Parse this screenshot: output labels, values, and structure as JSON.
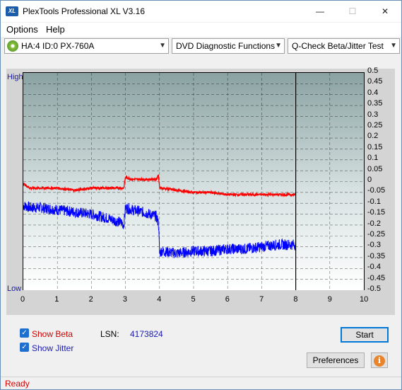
{
  "window": {
    "title": "PlexTools Professional XL V3.16",
    "logo_text": "XL"
  },
  "titlebar_buttons": {
    "minimize": "—",
    "maximize": "☐",
    "close": "✕"
  },
  "menu": {
    "options": "Options",
    "help": "Help"
  },
  "toolbar": {
    "drive": "HA:4 ID:0  PX-760A",
    "function": "DVD Diagnostic Functions",
    "test": "Q-Check Beta/Jitter Test"
  },
  "graph": {
    "label_high": "High",
    "label_low": "Low",
    "y_ticks": [
      "0.5",
      "0.45",
      "0.4",
      "0.35",
      "0.3",
      "0.25",
      "0.2",
      "0.15",
      "0.1",
      "0.05",
      "0",
      "-0.05",
      "-0.1",
      "-0.15",
      "-0.2",
      "-0.25",
      "-0.3",
      "-0.35",
      "-0.4",
      "-0.45",
      "-0.5"
    ],
    "x_ticks": [
      "0",
      "1",
      "2",
      "3",
      "4",
      "5",
      "6",
      "7",
      "8",
      "9",
      "10"
    ],
    "colors": {
      "beta": "#ff0000",
      "jitter": "#0000ff",
      "marker": "#000000"
    }
  },
  "chart_data": {
    "type": "line",
    "x": [
      0,
      0.2,
      0.5,
      1,
      1.5,
      2,
      2.5,
      2.9,
      2.95,
      3.0,
      3.2,
      3.5,
      3.9,
      3.97,
      4.0,
      4.05,
      4.5,
      5,
      5.5,
      6,
      6.5,
      7,
      7.5,
      8
    ],
    "series": [
      {
        "name": "Beta",
        "values": [
          -0.01,
          -0.03,
          -0.03,
          -0.03,
          -0.04,
          -0.03,
          -0.03,
          -0.03,
          -0.03,
          0.02,
          0.01,
          0.01,
          0.01,
          0.03,
          -0.03,
          -0.03,
          -0.04,
          -0.05,
          -0.05,
          -0.06,
          -0.06,
          -0.06,
          -0.06,
          -0.06
        ]
      },
      {
        "name": "Jitter",
        "values": [
          -0.11,
          -0.12,
          -0.12,
          -0.13,
          -0.14,
          -0.15,
          -0.17,
          -0.19,
          -0.2,
          -0.12,
          -0.13,
          -0.14,
          -0.16,
          -0.19,
          -0.33,
          -0.32,
          -0.33,
          -0.32,
          -0.32,
          -0.31,
          -0.31,
          -0.3,
          -0.29,
          -0.29
        ]
      }
    ],
    "xlim": [
      0,
      10
    ],
    "ylim": [
      -0.5,
      0.5
    ],
    "marker_x": 8,
    "grid": true
  },
  "options": {
    "show_beta": "Show Beta",
    "show_jitter": "Show Jitter",
    "checked_glyph": "✓",
    "lsn_label": "LSN:",
    "lsn_value": "4173824"
  },
  "buttons": {
    "start": "Start",
    "preferences": "Preferences",
    "info": "i"
  },
  "status": {
    "text": "Ready"
  }
}
